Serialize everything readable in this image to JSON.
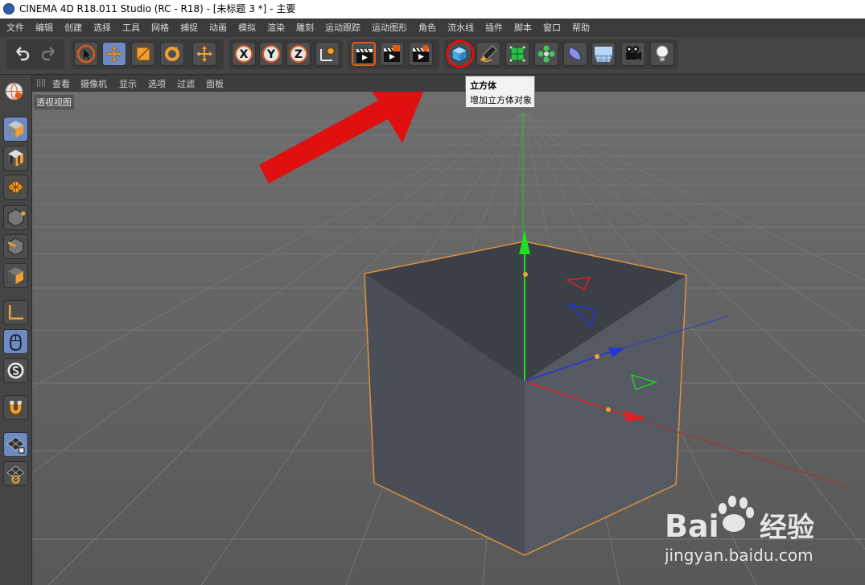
{
  "window": {
    "title": "CINEMA 4D R18.011 Studio (RC - R18) - [未标题 3 *] - 主要"
  },
  "menu": [
    "文件",
    "编辑",
    "创建",
    "选择",
    "工具",
    "网格",
    "捕捉",
    "动画",
    "模拟",
    "渲染",
    "雕刻",
    "运动跟踪",
    "运动图形",
    "角色",
    "流水线",
    "插件",
    "脚本",
    "窗口",
    "帮助"
  ],
  "toolbar": {
    "undo_icon": "undo-icon",
    "redo_icon": "redo-icon",
    "axis_x": "X",
    "axis_y": "Y",
    "axis_z": "Z"
  },
  "viewport_menu": [
    "查看",
    "摄像机",
    "显示",
    "选项",
    "过滤",
    "面板"
  ],
  "viewport": {
    "label": "透视视图"
  },
  "tooltip": {
    "title": "立方体",
    "description": "增加立方体对象"
  },
  "watermark": {
    "brand_left": "Bai",
    "brand_right": "经验",
    "url": "jingyan.baidu.com"
  },
  "colors": {
    "accent_orange": "#f0a030",
    "selection_blue": "#6d8ac5",
    "highlight_red": "#e01010",
    "axis_green": "#22cc22",
    "axis_red": "#e02020",
    "axis_blue": "#2233dd"
  }
}
